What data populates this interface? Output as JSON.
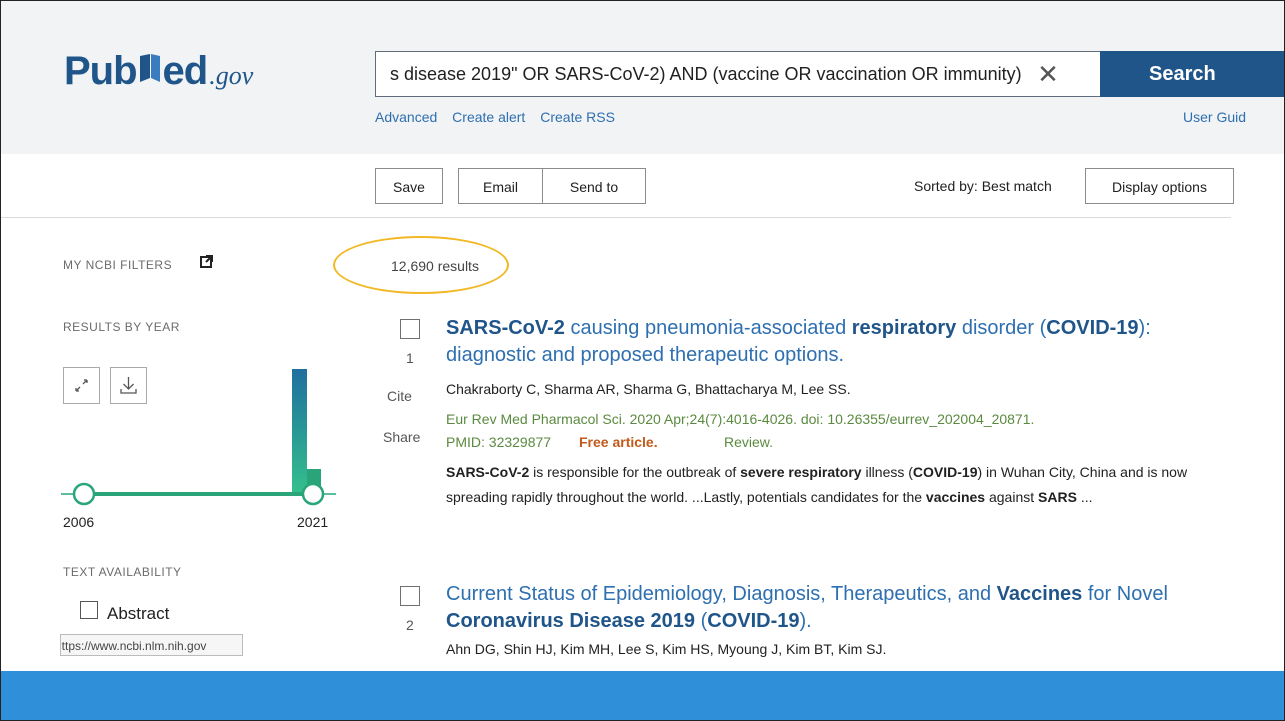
{
  "header": {
    "logo": {
      "pub": "Pub",
      "med": "ed",
      "gov": ".gov"
    },
    "search_query": "s disease 2019\" OR SARS-CoV-2) AND (vaccine OR vaccination OR immunity)",
    "search_button": "Search",
    "links": [
      "Advanced",
      "Create alert",
      "Create RSS"
    ],
    "user_guide": "User Guid"
  },
  "toolbar": {
    "save": "Save",
    "email": "Email",
    "send_to": "Send to",
    "sorted_by": "Sorted by: Best match",
    "display_options": "Display options"
  },
  "sidebar": {
    "my_ncbi_filters": "MY NCBI FILTERS",
    "results_by_year": "RESULTS BY YEAR",
    "year_start": "2006",
    "year_end": "2021",
    "text_availability": "TEXT AVAILABILITY",
    "abstract_label": "Abstract",
    "url_tooltip": "https://www.ncbi.nlm.nih.gov"
  },
  "results_count": "12,690 results",
  "results": [
    {
      "number": "1",
      "cite": "Cite",
      "share": "Share",
      "title_parts": [
        {
          "t": "SARS-CoV-2",
          "b": true
        },
        {
          "t": " causing pneumonia-associated ",
          "b": false
        },
        {
          "t": "respiratory",
          "b": true
        },
        {
          "t": " disorder (",
          "b": false
        },
        {
          "t": "COVID-19",
          "b": true
        },
        {
          "t": "): diagnostic and proposed therapeutic options.",
          "b": false
        }
      ],
      "authors": "Chakraborty C, Sharma AR, Sharma G, Bhattacharya M, Lee SS.",
      "citation": "Eur Rev Med Pharmacol Sci. 2020 Apr;24(7):4016-4026. doi: 10.26355/eurrev_202004_20871.",
      "pmid": "PMID: 32329877",
      "free": "Free article.",
      "type": "Review.",
      "snippet_parts": [
        {
          "t": "SARS-CoV-2",
          "b": true
        },
        {
          "t": " is responsible for the outbreak of ",
          "b": false
        },
        {
          "t": "severe respiratory",
          "b": true
        },
        {
          "t": " illness (",
          "b": false
        },
        {
          "t": "COVID-19",
          "b": true
        },
        {
          "t": ") in Wuhan City, China and is now spreading rapidly throughout the world. ...Lastly, potentials candidates for the ",
          "b": false
        },
        {
          "t": "vaccines",
          "b": true
        },
        {
          "t": " against ",
          "b": false
        },
        {
          "t": "SARS",
          "b": true
        },
        {
          "t": " ...",
          "b": false
        }
      ]
    },
    {
      "number": "2",
      "title_parts": [
        {
          "t": "Current Status of Epidemiology, Diagnosis, Therapeutics, and ",
          "b": false
        },
        {
          "t": "Vaccines",
          "b": true
        },
        {
          "t": " for Novel ",
          "b": false
        },
        {
          "t": "Coronavirus Disease 2019",
          "b": true
        },
        {
          "t": " (",
          "b": false
        },
        {
          "t": "COVID-19",
          "b": true
        },
        {
          "t": ").",
          "b": false
        }
      ],
      "authors": "Ahn DG, Shin HJ, Kim MH, Lee S, Kim HS, Myoung J, Kim BT, Kim SJ."
    }
  ],
  "colors": {
    "brand": "#20558a",
    "link": "#2e6fb0",
    "highlight_circle": "#f2b824",
    "footer": "#2f8fd8",
    "free_article": "#c05b1b"
  }
}
